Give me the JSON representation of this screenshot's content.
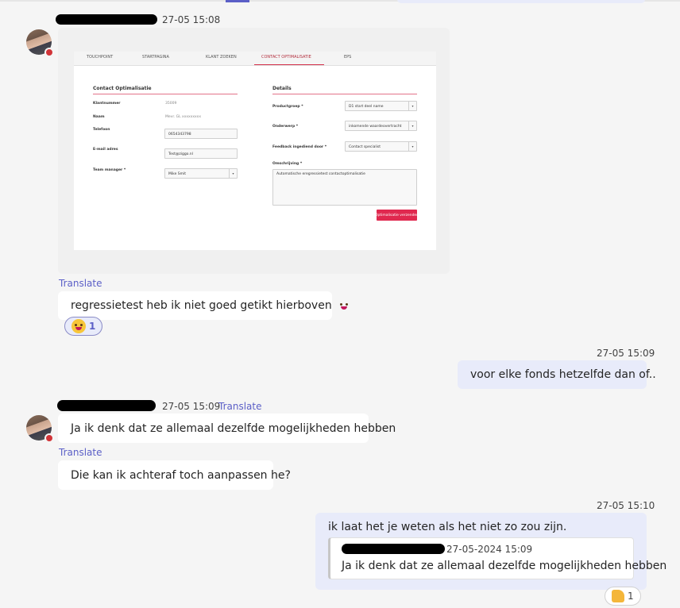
{
  "colors": {
    "accent": "#5b5fc7",
    "own_bubble": "#e8ebfa",
    "other_bubble": "#ffffff",
    "presence_busy": "#d13438",
    "form_accent": "#e0294f"
  },
  "messages": [
    {
      "sender": "other",
      "timestamp": "27-05 15:08",
      "avatar": "avatar-photo",
      "status_icon": "busy-status-icon",
      "attachment": {
        "tabs": [
          "TOUCHPOINT",
          "STARTPAGINA",
          "KLANT ZOEKEN",
          "CONTACT OPTIMALISATIE",
          "EPS"
        ],
        "left_section": {
          "title": "Contact Optimalisatie",
          "fields": [
            {
              "label": "Klantnummer",
              "value": "35009"
            },
            {
              "label": "Naam",
              "value": "Mevr. GL xxxxxxxxx"
            },
            {
              "label": "Telefoon",
              "value": "0654343798"
            },
            {
              "label": "E-mail adres",
              "value": "Test@ziggo.nl"
            },
            {
              "label": "Team manager *",
              "value": "Mike Smit"
            }
          ]
        },
        "right_section": {
          "title": "Details",
          "fields": [
            {
              "label": "Productgroep *",
              "value": "D1 start deel name"
            },
            {
              "label": "Onderwerp *",
              "value": "inkomende waardeovertracht"
            },
            {
              "label": "Feedback ingediend door *",
              "value": "Contact specialist"
            },
            {
              "label": "Omschrijving *",
              "value": "Automatische eregressietest contactoptimalisatie"
            }
          ],
          "button": "Optimalisatie verzenden"
        }
      },
      "translate": "Translate",
      "text": "regressietest heb ik niet goed getikt hierboven",
      "inline_emoji": "grinning-tongue-emoji",
      "reaction": {
        "emoji": "grinning-tongue-emoji",
        "count": "1"
      }
    },
    {
      "sender": "me",
      "timestamp": "27-05 15:09",
      "text": "voor elke fonds hetzelfde dan of.."
    },
    {
      "sender": "other",
      "timestamp": "27-05 15:09",
      "translate": "Translate",
      "avatar": "avatar-photo",
      "text": "Ja ik denk dat ze allemaal dezelfde mogelijkheden hebben"
    },
    {
      "sender": "other",
      "translate": "Translate",
      "text": "Die kan ik achteraf toch aanpassen he?"
    },
    {
      "sender": "me",
      "timestamp": "27-05 15:10",
      "text": "ik laat het je weten als het niet zo zou zijn.",
      "quote": {
        "timestamp": "27-05-2024 15:09",
        "text": "Ja ik denk dat ze allemaal dezelfde mogelijkheden hebben"
      },
      "reaction": {
        "emoji": "thumbs-up-emoji",
        "count": "1"
      }
    }
  ]
}
